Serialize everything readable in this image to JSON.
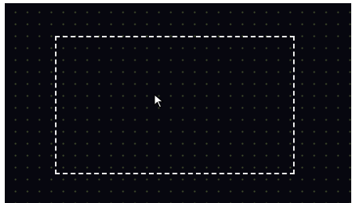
{
  "canvas": {
    "background_color": "#07070f",
    "grid_dot_color": "#3f4a2c",
    "grid_visible": true
  },
  "selection": {
    "style": "dashed",
    "border_color": "#e8e8e8"
  },
  "cursor": {
    "icon": "arrow-pointer-icon",
    "color": "#ffffff"
  }
}
